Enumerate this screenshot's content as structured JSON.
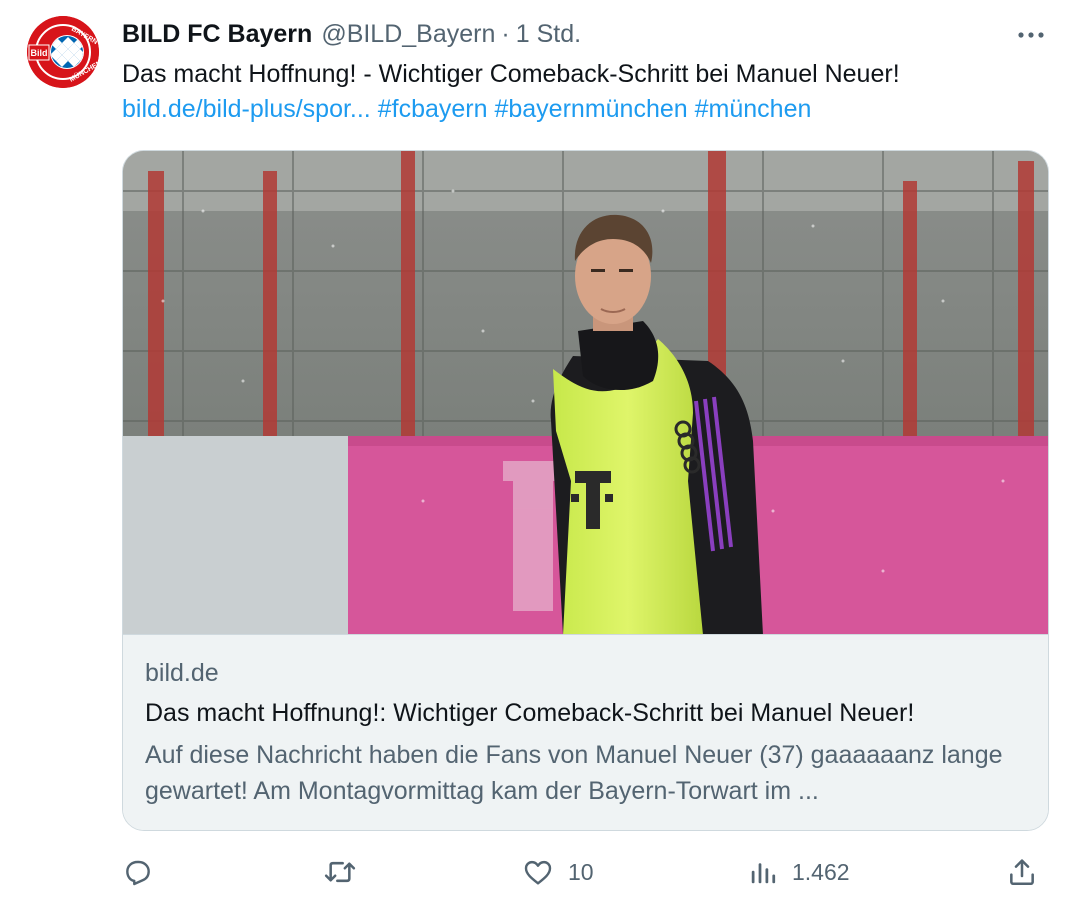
{
  "tweet": {
    "author": {
      "display_name": "BILD FC Bayern",
      "handle": "@BILD_Bayern",
      "separator": "·",
      "time": "1 Std.",
      "avatar_icon": "bayern-bild-logo"
    },
    "text": "Das macht Hoffnung! - Wichtiger Comeback-Schritt bei Manuel Neuer!",
    "link": "bild.de/bild-plus/spor...",
    "hashtags": [
      "#fcbayern",
      "#bayernmünchen",
      "#münchen"
    ],
    "more_icon": "more-horizontal-icon"
  },
  "card": {
    "domain": "bild.de",
    "title": "Das macht Hoffnung!: Wichtiger Comeback-Schritt bei Manuel Neuer!",
    "description": "Auf diese Nachricht haben die Fans von Manuel Neuer (37) gaaaaaanz lange gewartet! Am Montagvormittag kam der Bayern-Torwart im ..."
  },
  "actions": {
    "reply": {
      "icon": "reply-icon",
      "count": ""
    },
    "retweet": {
      "icon": "retweet-icon",
      "count": ""
    },
    "like": {
      "icon": "heart-icon",
      "count": "10"
    },
    "views": {
      "icon": "views-chart-icon",
      "count": "1.462"
    },
    "share": {
      "icon": "share-icon"
    }
  },
  "colors": {
    "link": "#1d9bf0",
    "secondary_text": "#536471",
    "primary_text": "#0f1419",
    "card_footer_bg": "#eff3f4",
    "bayern_red": "#d7141a",
    "telekom_magenta": "#e20074"
  }
}
